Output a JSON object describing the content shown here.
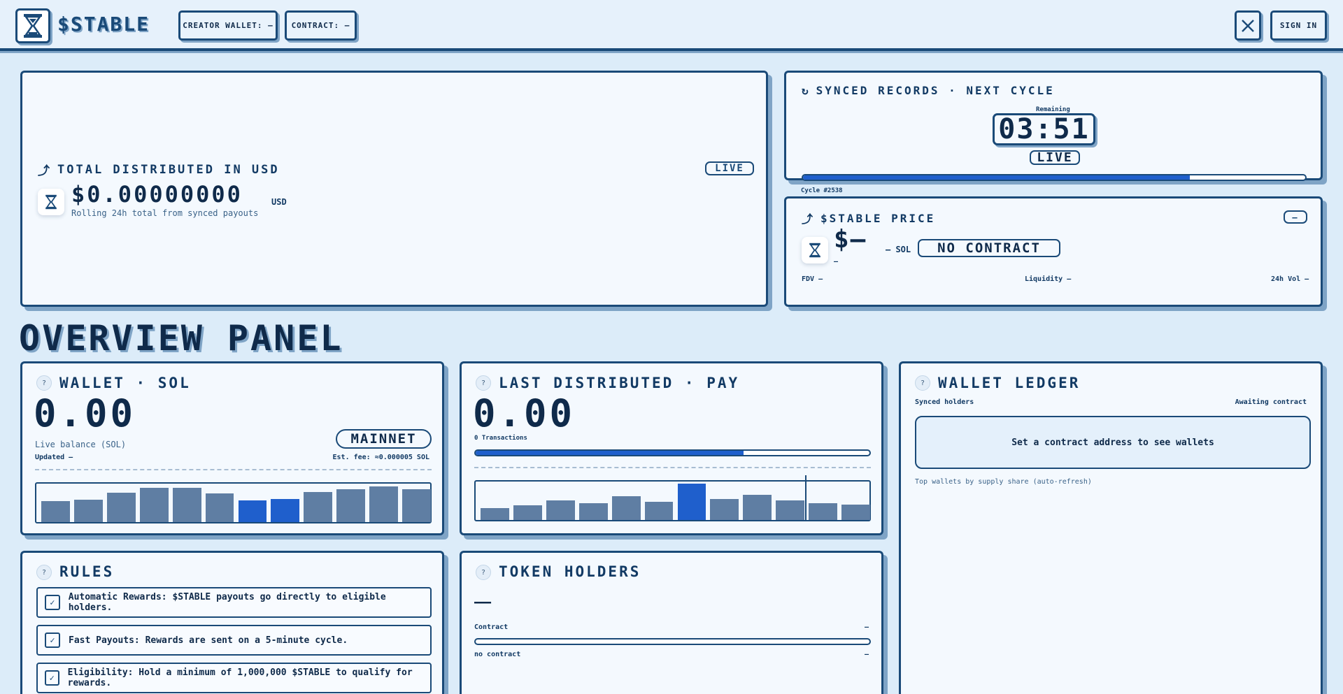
{
  "header": {
    "brand": "$STABLE",
    "creator_wallet_label": "CREATOR WALLET: –",
    "contract_label": "CONTRACT: –",
    "x_icon": "x-logo-icon",
    "sign_in_label": "SIGN IN"
  },
  "total_distributed": {
    "title": "TOTAL DISTRIBUTED IN USD",
    "badge": "LIVE",
    "value": "$0.00000000",
    "unit": "USD",
    "caption": "Rolling 24h total from synced payouts"
  },
  "synced": {
    "title": "SYNCED RECORDS · NEXT CYCLE",
    "remaining_label": "Remaining",
    "timer": "03:51",
    "badge": "LIVE",
    "progress": 0.77,
    "cycle": "Cycle #2538"
  },
  "price": {
    "title": "$STABLE PRICE",
    "collapse_label": "—",
    "value": "$—",
    "sol_label": "– SOL",
    "contract_badge": "NO CONTRACT",
    "change": "–",
    "fdv": "FDV –",
    "liquidity": "Liquidity –",
    "vol": "24h Vol –"
  },
  "overview_heading": "OVERVIEW PANEL",
  "wallet": {
    "title": "WALLET · SOL",
    "value": "0.00",
    "badge": "MAINNET",
    "caption": "Live balance (SOL)",
    "updated": "Updated –",
    "fee": "Est. fee: ≈0.000005 SOL",
    "bars": [
      0.58,
      0.62,
      0.81,
      0.94,
      0.94,
      0.79,
      0.6,
      0.64,
      0.83,
      0.91,
      0.98,
      0.9
    ],
    "highlight": [
      6,
      7
    ]
  },
  "last_distributed": {
    "title": "LAST DISTRIBUTED · PAY",
    "value": "0.00",
    "transactions": "0 Transactions",
    "progress": 0.68,
    "bars": [
      0.33,
      0.4,
      0.53,
      0.47,
      0.66,
      0.5,
      1.0,
      0.58,
      0.7,
      0.54,
      0.47,
      0.43
    ],
    "highlight": [
      6
    ]
  },
  "ledger": {
    "title": "WALLET LEDGER",
    "synced_label": "Synced holders",
    "status": "Awaiting contract",
    "empty_message": "Set a contract address to see wallets",
    "caption": "Top wallets by supply share (auto-refresh)"
  },
  "rules": {
    "title": "RULES",
    "items": [
      "Automatic Rewards: $STABLE payouts go directly to eligible holders.",
      "Fast Payouts: Rewards are sent on a 5-minute cycle.",
      "Eligibility: Hold a minimum of 1,000,000 $STABLE to qualify for rewards."
    ]
  },
  "holders": {
    "title": "TOKEN HOLDERS",
    "value": "—",
    "contract_label": "Contract",
    "contract_value": "–",
    "no_contract_label": "no contract",
    "no_contract_value": "–"
  },
  "colors": {
    "accent": "#1f5fcc",
    "navy": "#1a4a78",
    "bg": "#dcecf9"
  }
}
